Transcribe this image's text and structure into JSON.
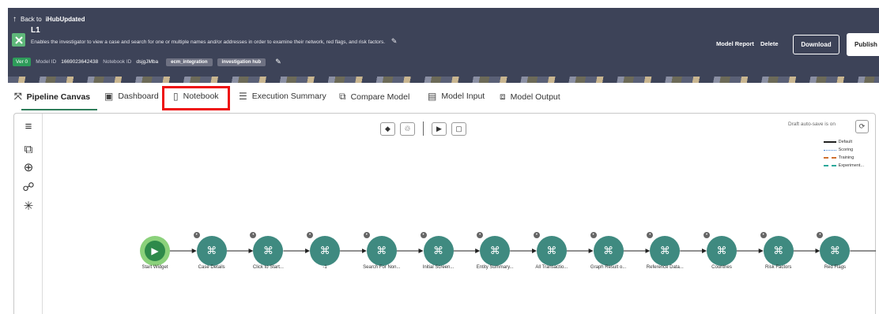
{
  "header": {
    "back_label": "Back to",
    "back_target": "iHubUpdated",
    "title": "L1",
    "description": "Enables the investigator to view a case and search for one or multiple names and/or addresses in order to examine their network, red flags, and risk factors.",
    "version": "Ver 0",
    "model_id_label": "Model ID",
    "model_id": "1669023642438",
    "notebook_id_label": "Notebook ID",
    "notebook_id": "dsjgJMba",
    "tags": [
      "ecm_integration",
      "investigation hub"
    ],
    "model_report": "Model Report",
    "delete": "Delete",
    "download": "Download",
    "publish": "Publish"
  },
  "tabs": [
    {
      "label": "Pipeline Canvas",
      "icon": "pipeline-icon"
    },
    {
      "label": "Dashboard",
      "icon": "dashboard-icon"
    },
    {
      "label": "Notebook",
      "icon": "notebook-icon"
    },
    {
      "label": "Execution Summary",
      "icon": "list-icon"
    },
    {
      "label": "Compare Model",
      "icon": "map-icon"
    },
    {
      "label": "Model Input",
      "icon": "form-icon"
    },
    {
      "label": "Model Output",
      "icon": "output-icon"
    }
  ],
  "canvas": {
    "autosave": "Draft auto-save is on",
    "legend": [
      "Default",
      "Scoring",
      "Training",
      "Experiment..."
    ],
    "nodes": [
      {
        "label": "Start Widget"
      },
      {
        "label": "Case Details"
      },
      {
        "label": "Click to Start..."
      },
      {
        "label": "-1"
      },
      {
        "label": "Search For Non..."
      },
      {
        "label": "Initial Screen..."
      },
      {
        "label": "Entity Summary..."
      },
      {
        "label": "All Transactio..."
      },
      {
        "label": "Graph Result o..."
      },
      {
        "label": "Reference Data..."
      },
      {
        "label": "Countries"
      },
      {
        "label": "Risk Factors"
      },
      {
        "label": "Red Flags"
      }
    ]
  },
  "colors": {
    "header_bg": "#3d4358",
    "accent_green": "#2e7d5a",
    "node_teal": "#3f8a80",
    "highlight_red": "#ee1111"
  }
}
